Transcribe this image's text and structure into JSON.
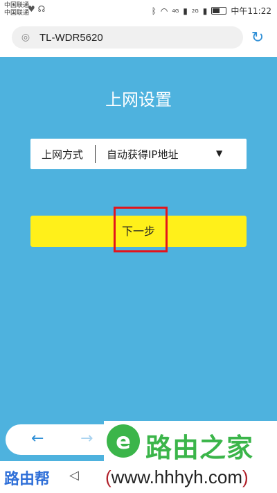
{
  "status_bar": {
    "carrier_1": "中国联通",
    "carrier_2": "中国联通",
    "network_1": "4G",
    "network_2": "2G",
    "time": "中午11:22"
  },
  "browser": {
    "url": "TL-WDR5620"
  },
  "page": {
    "title": "上网设置",
    "connection_type_label": "上网方式",
    "connection_type_value": "自动获得IP地址",
    "next_button_label": "下一步"
  },
  "watermark": {
    "logo_text": "路由之家",
    "brand_left": "路由帮",
    "url_text": "www.hhhyh.com"
  },
  "colors": {
    "background": "#4eb2de",
    "button": "#fff01a",
    "highlight": "#e3141c",
    "logo_green": "#3bb54a",
    "accent_blue": "#2f8fd6"
  }
}
